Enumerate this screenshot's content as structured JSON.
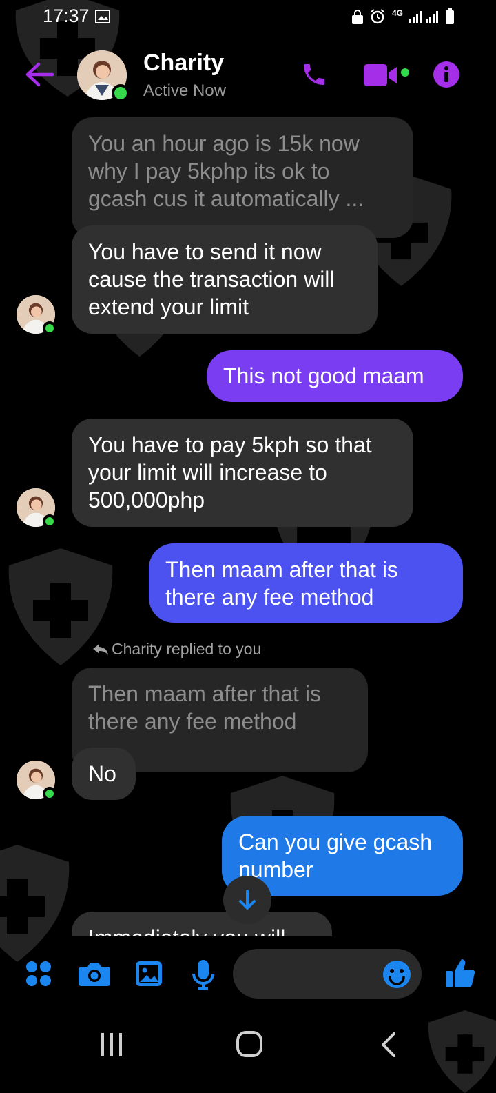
{
  "status_bar": {
    "time": "17:37",
    "network_label": "4G"
  },
  "header": {
    "contact_name": "Charity",
    "contact_status": "Active Now"
  },
  "messages": [
    {
      "from": "contact",
      "style": "quoted-faded",
      "lines": [
        "You an hour ago is 15k now",
        "why  I pay 5kphp its ok to",
        "gcash cus it automatically  ..."
      ]
    },
    {
      "from": "contact",
      "style": "normal",
      "lines": [
        "You have to send it now",
        "cause the transaction will",
        "extend your limit"
      ]
    },
    {
      "from": "me",
      "style": "purple",
      "lines": [
        "This not good maam"
      ]
    },
    {
      "from": "contact",
      "style": "normal",
      "lines": [
        "You have to pay 5kph so that",
        "your limit will increase to",
        "500,000php"
      ]
    },
    {
      "from": "me",
      "style": "indigo",
      "lines": [
        "Then maam  after that is",
        "there  any fee method"
      ]
    },
    {
      "from": "contact",
      "style": "quoted-faded",
      "lines": [
        "Then maam  after that is",
        "there  any fee method"
      ]
    },
    {
      "from": "contact",
      "style": "normal",
      "lines": [
        "No"
      ]
    },
    {
      "from": "me",
      "style": "blue",
      "lines": [
        "Can you give gcash",
        "number"
      ]
    },
    {
      "from": "contact",
      "style": "normal",
      "lines": [
        "Immediately  you will"
      ]
    }
  ],
  "reply_indicator": "Charity replied to you",
  "colors": {
    "accent_purple": "#a52ee8",
    "messenger_blue": "#1b86ef",
    "online_green": "#35d94a",
    "bubble_gray": "#303030"
  },
  "icons": {
    "back": "back-arrow-icon",
    "call": "phone-icon",
    "video": "video-camera-icon",
    "info": "info-icon",
    "menu": "four-dots-icon",
    "camera": "camera-icon",
    "gallery": "image-icon",
    "mic": "microphone-icon",
    "emoji": "smiley-icon",
    "like": "thumbs-up-icon",
    "scroll_down": "down-arrow-icon"
  }
}
